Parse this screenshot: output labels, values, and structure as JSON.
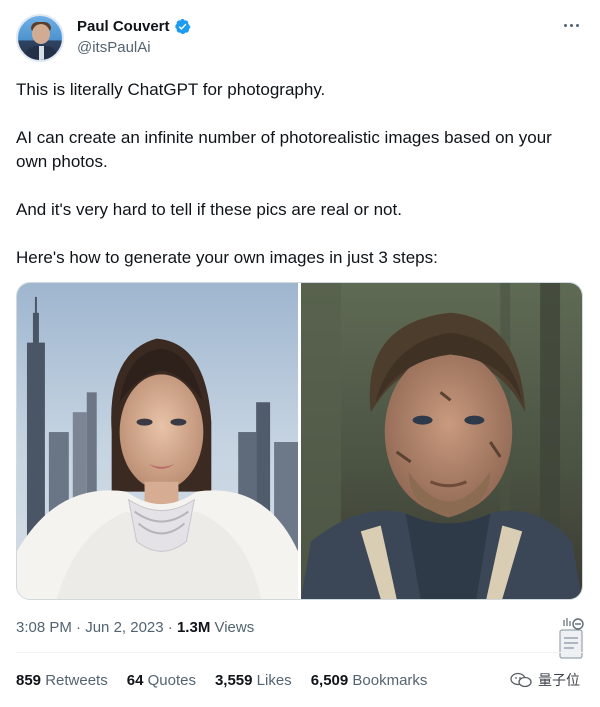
{
  "author": {
    "display_name": "Paul Couvert",
    "handle": "@itsPaulAi",
    "verified": true
  },
  "icons": {
    "verified": "verified-badge-icon",
    "more": "more-options-icon"
  },
  "tweet": {
    "paragraphs": [
      "This is literally ChatGPT for photography.",
      "AI can create an infinite number of photorealistic images based on your own photos.",
      "And it's very hard to tell if these pics are real or not.",
      "Here's how to generate your own images in just 3 steps:"
    ],
    "images": [
      "woman-portrait-city-background",
      "man-portrait-muddy-forest"
    ]
  },
  "meta": {
    "time": "3:08 PM",
    "sep1": " · ",
    "date": "Jun 2, 2023",
    "sep2": " · ",
    "views_count": "1.3M",
    "views_label": " Views"
  },
  "stats": [
    {
      "count": "859",
      "label": " Retweets"
    },
    {
      "count": "64",
      "label": " Quotes"
    },
    {
      "count": "3,559",
      "label": " Likes"
    },
    {
      "count": "6,509",
      "label": " Bookmarks"
    }
  ],
  "watermark": {
    "text": "量子位"
  },
  "colors": {
    "primary_text": "#0f1419",
    "secondary_text": "#536471",
    "verified": "#1d9bf0",
    "border": "#cfd9de"
  }
}
